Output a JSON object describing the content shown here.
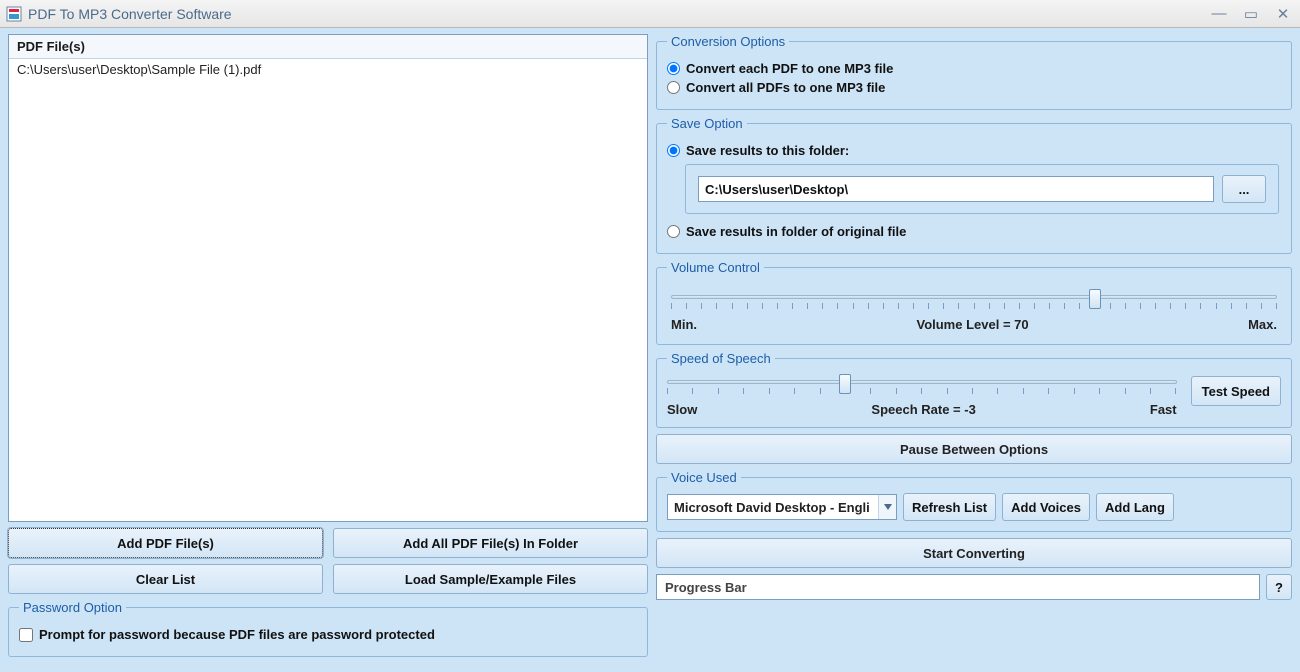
{
  "window": {
    "title": "PDF To MP3 Converter Software"
  },
  "leftPanel": {
    "listHeader": "PDF File(s)",
    "files": [
      "C:\\Users\\user\\Desktop\\Sample File (1).pdf"
    ],
    "buttons": {
      "addFiles": "Add PDF File(s)",
      "addFolder": "Add All PDF File(s) In Folder",
      "clear": "Clear List",
      "loadSample": "Load Sample/Example Files"
    },
    "passwordOption": {
      "legend": "Password Option",
      "checkboxLabel": "Prompt for password because PDF files are password protected",
      "checked": false
    }
  },
  "conversion": {
    "legend": "Conversion Options",
    "opt1": "Convert each PDF to one MP3 file",
    "opt2": "Convert all PDFs to one MP3 file",
    "selected": 1
  },
  "saveOption": {
    "legend": "Save Option",
    "opt1": "Save results to this folder:",
    "folderPath": "C:\\Users\\user\\Desktop\\",
    "browse": "...",
    "opt2": "Save results in folder of original file",
    "selected": 1
  },
  "volume": {
    "legend": "Volume Control",
    "minLabel": "Min.",
    "maxLabel": "Max.",
    "levelLabel": "Volume Level = 70",
    "value": 70,
    "min": 0,
    "max": 100
  },
  "speed": {
    "legend": "Speed of Speech",
    "slowLabel": "Slow",
    "fastLabel": "Fast",
    "rateLabel": "Speech Rate = -3",
    "testBtn": "Test Speed",
    "value": -3,
    "min": -10,
    "max": 10
  },
  "pauseBtn": "Pause Between Options",
  "voice": {
    "legend": "Voice Used",
    "selected": "Microsoft David Desktop - Engli",
    "refresh": "Refresh List",
    "addVoices": "Add Voices",
    "addLang": "Add Lang"
  },
  "startBtn": "Start Converting",
  "progress": {
    "text": "Progress Bar",
    "help": "?"
  }
}
